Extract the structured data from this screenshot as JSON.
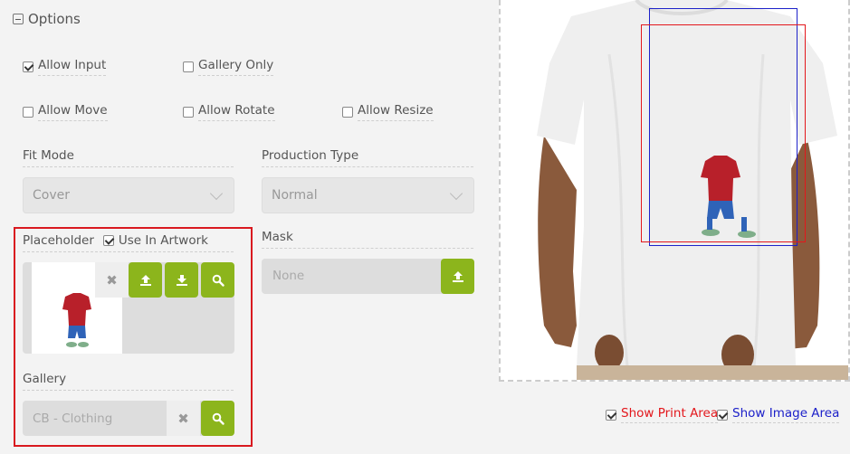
{
  "section": {
    "title": "Options"
  },
  "options": {
    "allow_input": {
      "label": "Allow Input",
      "checked": true
    },
    "gallery_only": {
      "label": "Gallery Only",
      "checked": false
    },
    "allow_move": {
      "label": "Allow Move",
      "checked": false
    },
    "allow_rotate": {
      "label": "Allow Rotate",
      "checked": false
    },
    "allow_resize": {
      "label": "Allow Resize",
      "checked": false
    }
  },
  "fit_mode": {
    "label": "Fit Mode",
    "value": "Cover"
  },
  "production_type": {
    "label": "Production Type",
    "value": "Normal"
  },
  "placeholder": {
    "label": "Placeholder",
    "use_in_artwork_label": "Use In Artwork",
    "use_in_artwork_checked": true
  },
  "mask": {
    "label": "Mask",
    "value": "None"
  },
  "gallery": {
    "label": "Gallery",
    "value": "CB - Clothing"
  },
  "preview": {
    "show_print_area": {
      "label": "Show Print Area",
      "checked": true,
      "color": "#e3171c"
    },
    "show_image_area": {
      "label": "Show Image Area",
      "checked": true,
      "color": "#1d21c9"
    }
  },
  "colors": {
    "accent_green": "#8cb51c",
    "highlight_red": "#d9191f",
    "print_area": "#e3171c",
    "image_area": "#1d21c9"
  }
}
